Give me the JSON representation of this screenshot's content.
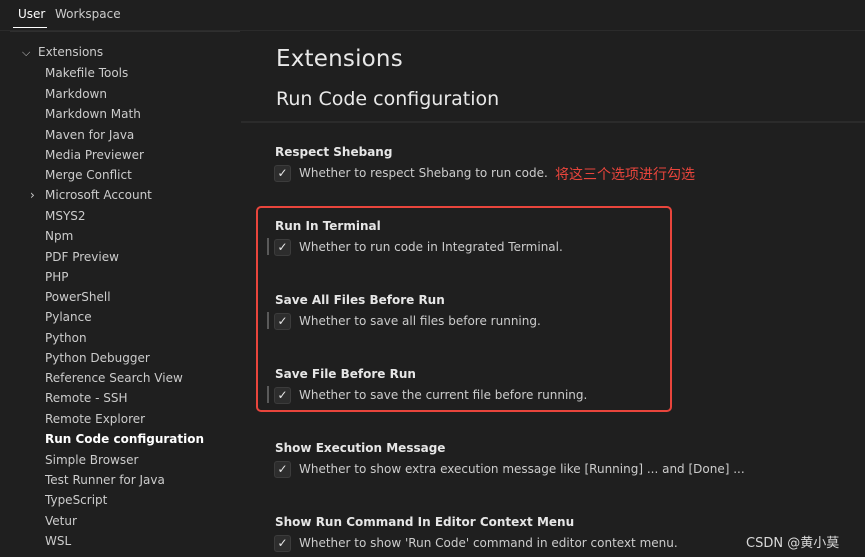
{
  "tabs": {
    "user": "User",
    "workspace": "Workspace"
  },
  "tree": {
    "root_label": "Extensions",
    "items": [
      "Makefile Tools",
      "Markdown",
      "Markdown Math",
      "Maven for Java",
      "Media Previewer",
      "Merge Conflict",
      "Microsoft Account",
      "MSYS2",
      "Npm",
      "PDF Preview",
      "PHP",
      "PowerShell",
      "Pylance",
      "Python",
      "Python Debugger",
      "Reference Search View",
      "Remote - SSH",
      "Remote Explorer",
      "Run Code configuration",
      "Simple Browser",
      "Test Runner for Java",
      "TypeScript",
      "Vetur",
      "WSL"
    ],
    "active_item": "Run Code configuration",
    "collapsed_item": "Microsoft Account"
  },
  "main": {
    "heading": "Extensions",
    "subheading": "Run Code configuration",
    "annotation": "将这三个选项进行勾选",
    "settings": [
      {
        "title": "Respect Shebang",
        "desc": "Whether to respect Shebang to run code.",
        "checked": true
      },
      {
        "title": "Run In Terminal",
        "desc": "Whether to run code in Integrated Terminal.",
        "checked": true
      },
      {
        "title": "Save All Files Before Run",
        "desc": "Whether to save all files before running.",
        "checked": true
      },
      {
        "title": "Save File Before Run",
        "desc": "Whether to save the current file before running.",
        "checked": true
      },
      {
        "title": "Show Execution Message",
        "desc": "Whether to show extra execution message like [Running] ... and [Done] ...",
        "checked": true
      },
      {
        "title": "Show Run Command In Editor Context Menu",
        "desc": "Whether to show 'Run Code' command in editor context menu.",
        "checked": true
      }
    ],
    "check_glyph": "✓"
  },
  "watermark": "CSDN @黄小莫",
  "colors": {
    "background": "#1f1f1f",
    "annotation_red": "#e8453c"
  }
}
